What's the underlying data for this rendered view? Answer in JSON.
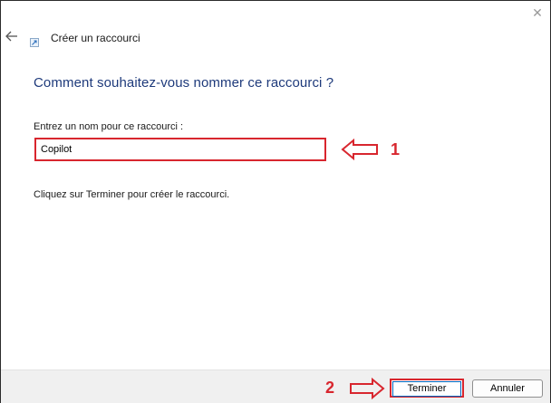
{
  "window": {
    "title": "Créer un raccourci",
    "close_icon": "close-icon",
    "back_icon": "back-arrow-icon",
    "app_icon": "shortcut-icon"
  },
  "content": {
    "heading": "Comment souhaitez-vous nommer ce raccourci ?",
    "field_label": "Entrez un nom pour ce raccourci :",
    "name_value": "Copilot",
    "hint": "Cliquez sur Terminer pour créer le raccourci."
  },
  "footer": {
    "finish_label": "Terminer",
    "cancel_label": "Annuler"
  },
  "annotations": [
    {
      "number": "1",
      "arrow_direction": "left",
      "target": "name-input"
    },
    {
      "number": "2",
      "arrow_direction": "right",
      "target": "finish-button"
    }
  ],
  "colors": {
    "annotation": "#d8262e",
    "heading": "#1e3a7b",
    "footer_bg": "#f0f0f0",
    "focus_border": "#0067c0"
  }
}
